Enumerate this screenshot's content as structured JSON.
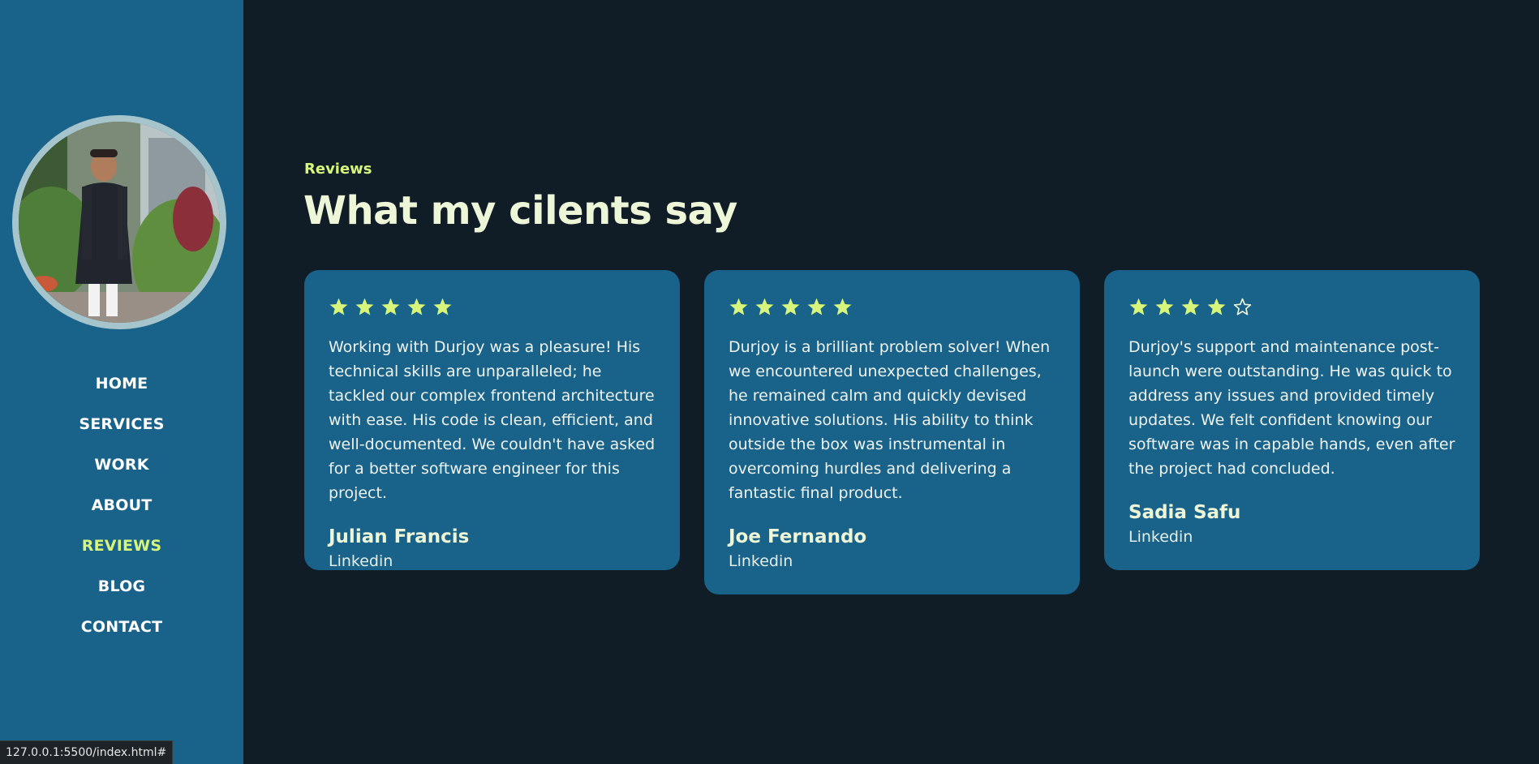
{
  "sidebar": {
    "nav": [
      {
        "label": "HOME",
        "active": false
      },
      {
        "label": "SERVICES",
        "active": false
      },
      {
        "label": "WORK",
        "active": false
      },
      {
        "label": "ABOUT",
        "active": false
      },
      {
        "label": "REVIEWS",
        "active": true
      },
      {
        "label": "BLOG",
        "active": false
      },
      {
        "label": "CONTACT",
        "active": false
      }
    ]
  },
  "section": {
    "eyebrow": "Reviews",
    "title": "What my cilents say"
  },
  "reviews": [
    {
      "rating": 5,
      "text": "Working with Durjoy was a pleasure! His technical skills are unparalleled; he tackled our complex frontend architecture with ease. His code is clean, efficient, and well-documented. We couldn't have asked for a better software engineer for this project.",
      "name": "Julian Francis",
      "source": "Linkedin"
    },
    {
      "rating": 5,
      "text": "Durjoy is a brilliant problem solver! When we encountered unexpected challenges, he remained calm and quickly devised innovative solutions. His ability to think outside the box was instrumental in overcoming hurdles and delivering a fantastic final product.",
      "name": "Joe Fernando",
      "source": "Linkedin"
    },
    {
      "rating": 4,
      "max_rating": 5,
      "text": "Durjoy's support and maintenance post-launch were outstanding. He was quick to address any issues and provided timely updates. We felt confident knowing our software was in capable hands, even after the project had concluded.",
      "name": "Sadia Safu",
      "source": "Linkedin"
    }
  ],
  "status_bar": {
    "url": "127.0.0.1:5500/index.html#"
  },
  "colors": {
    "background": "#111d26",
    "panel": "#19628a",
    "accent": "#d6f57a",
    "heading": "#eef6d8"
  },
  "icons": {
    "filled_star": "star-filled-icon",
    "empty_star": "star-outline-icon"
  }
}
